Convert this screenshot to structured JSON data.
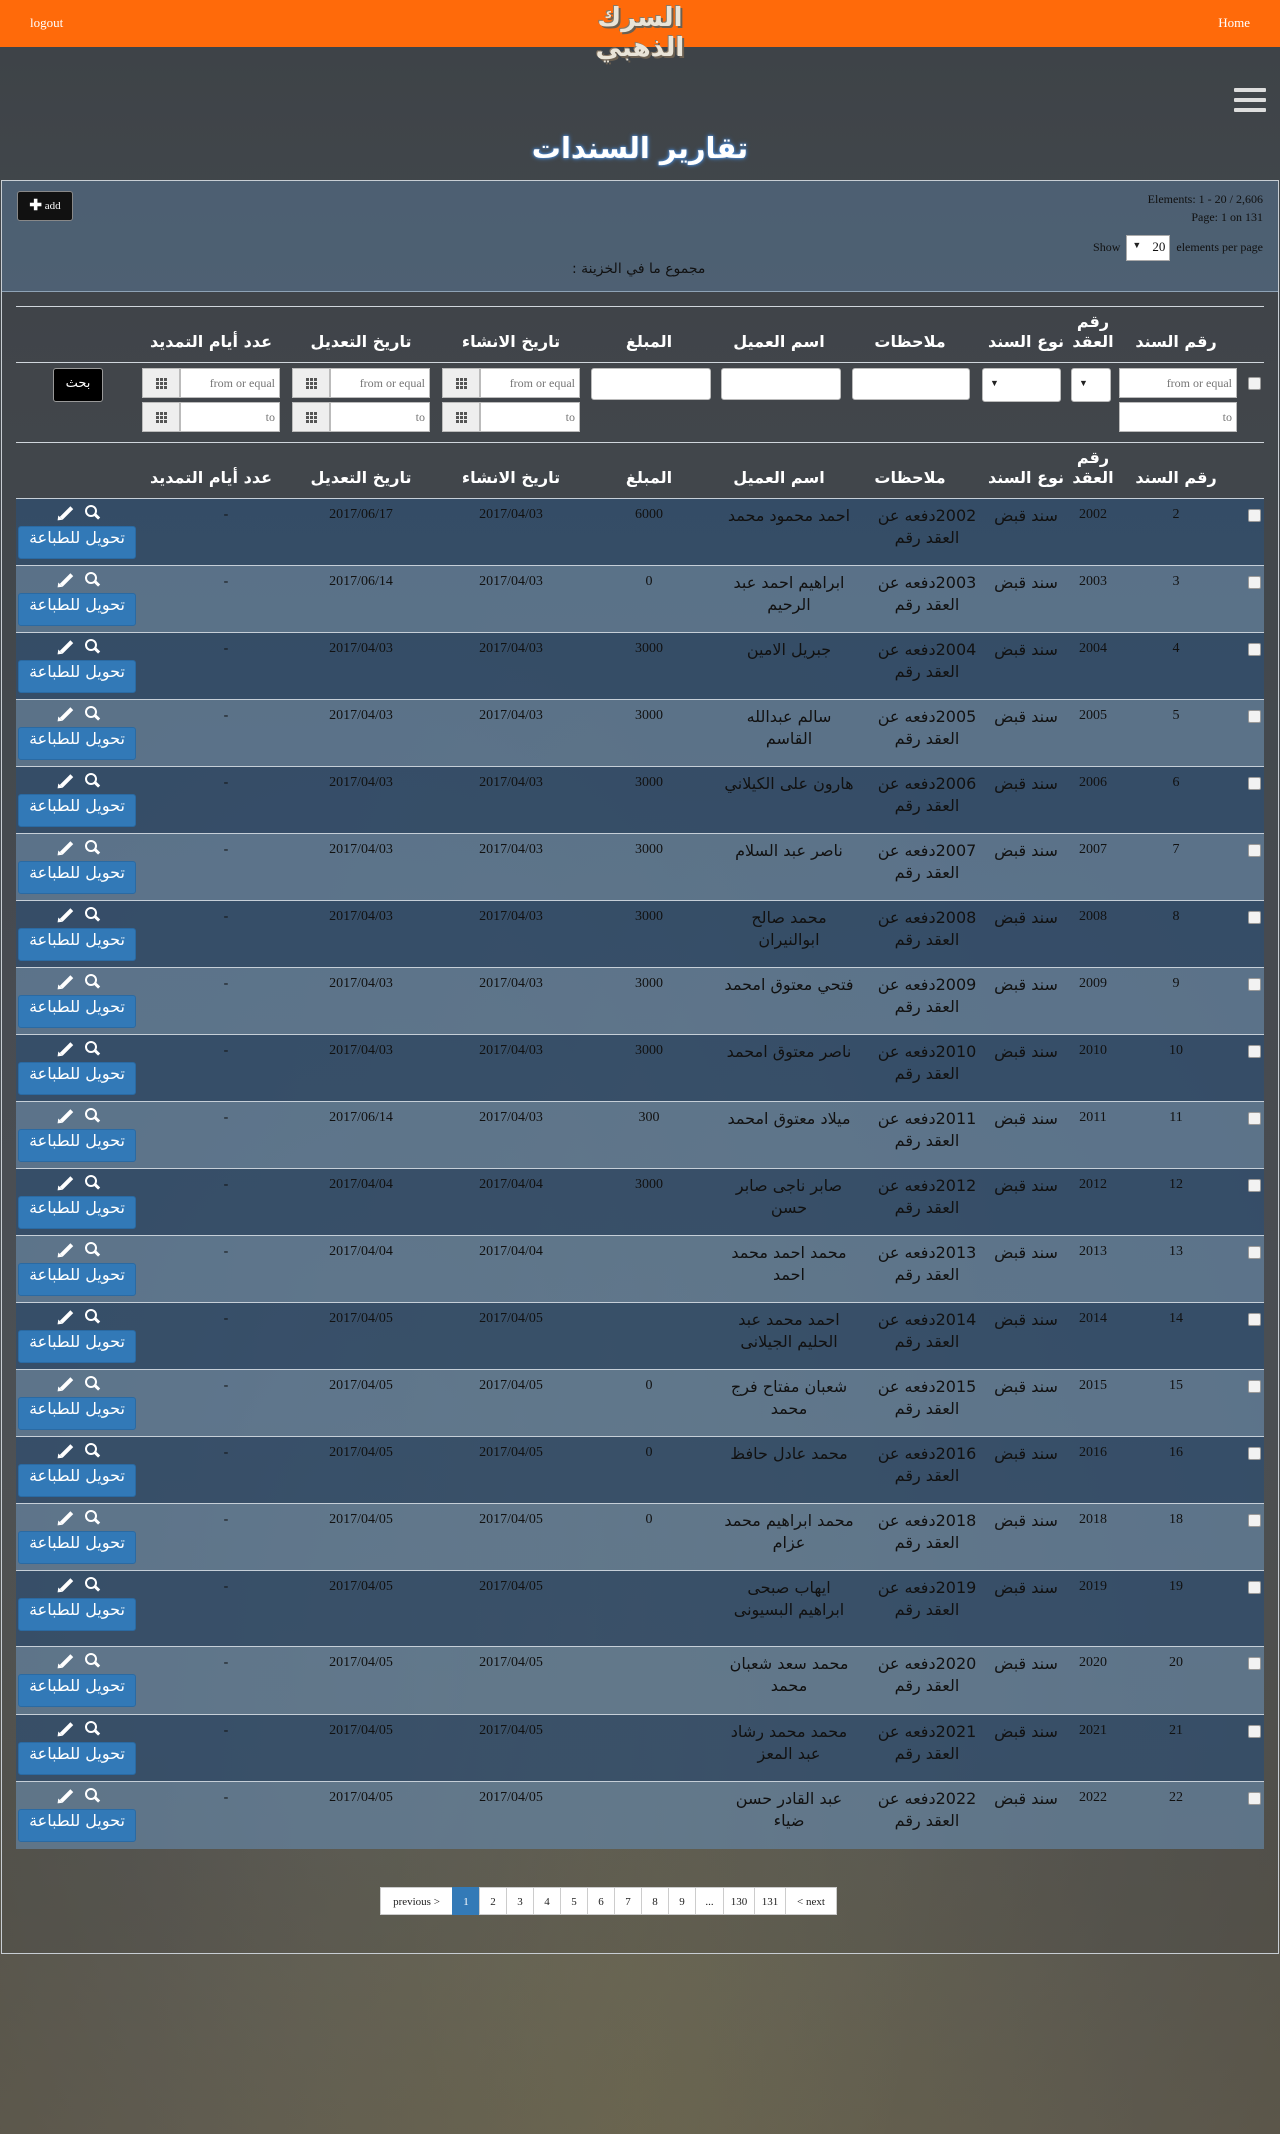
{
  "topbar": {
    "logout": "logout",
    "home": "Home",
    "logo": "السرك الذهبي"
  },
  "page_title": "تقارير السندات",
  "toolbar": {
    "add_label": "add",
    "elements_text": "Elements: 1 - 20 / 2,606",
    "page_text": "Page: 1 on 131",
    "show_label": "Show",
    "per_page_value": "20",
    "per_page_suffix": "elements per page",
    "treasury_text": "مجموع ما في الخزينة :"
  },
  "columns": {
    "bond_no": "رقم السند",
    "contract_no": "رقم العقد",
    "bond_type": "نوع السند",
    "notes": "ملاحظات",
    "client": "اسم العميل",
    "amount": "المبلغ",
    "created": "تاريخ الانشاء",
    "modified": "تاريخ التعديل",
    "ext_days": "عدد أيام التمديد"
  },
  "filters": {
    "from_placeholder": "from or equal",
    "to_placeholder": "to",
    "search_label": "بحث"
  },
  "row_actions": {
    "print_label": "تحويل للطباعة"
  },
  "rows": [
    {
      "id": "2",
      "contract": "2002",
      "type": "سند قبض",
      "notes": "2002دفعه عن العقد رقم",
      "client": "احمد محمود محمد",
      "amount": "6000",
      "created": "2017/04/03",
      "modified": "2017/06/17",
      "ext": "-"
    },
    {
      "id": "3",
      "contract": "2003",
      "type": "سند قبض",
      "notes": "2003دفعه عن العقد رقم",
      "client": "ابراهيم احمد عبد الرحيم",
      "amount": "0",
      "created": "2017/04/03",
      "modified": "2017/06/14",
      "ext": "-"
    },
    {
      "id": "4",
      "contract": "2004",
      "type": "سند قبض",
      "notes": "2004دفعه عن العقد رقم",
      "client": "جبريل الامين",
      "amount": "3000",
      "created": "2017/04/03",
      "modified": "2017/04/03",
      "ext": "-"
    },
    {
      "id": "5",
      "contract": "2005",
      "type": "سند قبض",
      "notes": "2005دفعه عن العقد رقم",
      "client": "سالم عبدالله القاسم",
      "amount": "3000",
      "created": "2017/04/03",
      "modified": "2017/04/03",
      "ext": "-"
    },
    {
      "id": "6",
      "contract": "2006",
      "type": "سند قبض",
      "notes": "2006دفعه عن العقد رقم",
      "client": "هارون على الكيلاني",
      "amount": "3000",
      "created": "2017/04/03",
      "modified": "2017/04/03",
      "ext": "-"
    },
    {
      "id": "7",
      "contract": "2007",
      "type": "سند قبض",
      "notes": "2007دفعه عن العقد رقم",
      "client": "ناصر عبد السلام",
      "amount": "3000",
      "created": "2017/04/03",
      "modified": "2017/04/03",
      "ext": "-"
    },
    {
      "id": "8",
      "contract": "2008",
      "type": "سند قبض",
      "notes": "2008دفعه عن العقد رقم",
      "client": "محمد صالح ابوالنيران",
      "amount": "3000",
      "created": "2017/04/03",
      "modified": "2017/04/03",
      "ext": "-"
    },
    {
      "id": "9",
      "contract": "2009",
      "type": "سند قبض",
      "notes": "2009دفعه عن العقد رقم",
      "client": "فتحي معتوق امحمد",
      "amount": "3000",
      "created": "2017/04/03",
      "modified": "2017/04/03",
      "ext": "-"
    },
    {
      "id": "10",
      "contract": "2010",
      "type": "سند قبض",
      "notes": "2010دفعه عن العقد رقم",
      "client": "ناصر معتوق امحمد",
      "amount": "3000",
      "created": "2017/04/03",
      "modified": "2017/04/03",
      "ext": "-"
    },
    {
      "id": "11",
      "contract": "2011",
      "type": "سند قبض",
      "notes": "2011دفعه عن العقد رقم",
      "client": "ميلاد معتوق امحمد",
      "amount": "300",
      "created": "2017/04/03",
      "modified": "2017/06/14",
      "ext": "-"
    },
    {
      "id": "12",
      "contract": "2012",
      "type": "سند قبض",
      "notes": "2012دفعه عن العقد رقم",
      "client": "صابر ناجى صابر حسن",
      "amount": "3000",
      "created": "2017/04/04",
      "modified": "2017/04/04",
      "ext": "-"
    },
    {
      "id": "13",
      "contract": "2013",
      "type": "سند قبض",
      "notes": "2013دفعه عن العقد رقم",
      "client": "محمد احمد محمد احمد",
      "amount": "",
      "created": "2017/04/04",
      "modified": "2017/04/04",
      "ext": "-"
    },
    {
      "id": "14",
      "contract": "2014",
      "type": "سند قبض",
      "notes": "2014دفعه عن العقد رقم",
      "client": "احمد محمد عبد الحليم الجيلانى",
      "amount": "",
      "created": "2017/04/05",
      "modified": "2017/04/05",
      "ext": "-"
    },
    {
      "id": "15",
      "contract": "2015",
      "type": "سند قبض",
      "notes": "2015دفعه عن العقد رقم",
      "client": "شعبان مفتاح فرج محمد",
      "amount": "0",
      "created": "2017/04/05",
      "modified": "2017/04/05",
      "ext": "-"
    },
    {
      "id": "16",
      "contract": "2016",
      "type": "سند قبض",
      "notes": "2016دفعه عن العقد رقم",
      "client": "محمد عادل حافظ",
      "amount": "0",
      "created": "2017/04/05",
      "modified": "2017/04/05",
      "ext": "-"
    },
    {
      "id": "18",
      "contract": "2018",
      "type": "سند قبض",
      "notes": "2018دفعه عن العقد رقم",
      "client": "محمد ابراهيم محمد عزام",
      "amount": "0",
      "created": "2017/04/05",
      "modified": "2017/04/05",
      "ext": "-"
    },
    {
      "id": "19",
      "contract": "2019",
      "type": "سند قبض",
      "notes": "2019دفعه عن العقد رقم",
      "client": "ايهاب صبحى ابراهيم البسيونى",
      "amount": "",
      "created": "2017/04/05",
      "modified": "2017/04/05",
      "ext": "-"
    },
    {
      "id": "20",
      "contract": "2020",
      "type": "سند قبض",
      "notes": "2020دفعه عن العقد رقم",
      "client": "محمد سعد شعبان محمد",
      "amount": "",
      "created": "2017/04/05",
      "modified": "2017/04/05",
      "ext": "-"
    },
    {
      "id": "21",
      "contract": "2021",
      "type": "سند قبض",
      "notes": "2021دفعه عن العقد رقم",
      "client": "محمد محمد رشاد عبد المعز",
      "amount": "",
      "created": "2017/04/05",
      "modified": "2017/04/05",
      "ext": "-"
    },
    {
      "id": "22",
      "contract": "2022",
      "type": "سند قبض",
      "notes": "2022دفعه عن العقد رقم",
      "client": "عبد القادر حسن ضياء",
      "amount": "",
      "created": "2017/04/05",
      "modified": "2017/04/05",
      "ext": "-"
    }
  ],
  "pagination": [
    "previous >",
    "1",
    "2",
    "3",
    "4",
    "5",
    "6",
    "7",
    "8",
    "9",
    "...",
    "130",
    "131",
    "< next"
  ],
  "pagination_active": "1",
  "colors": {
    "topbar": "#ff6a0a",
    "print_button": "#3279b7",
    "row_band": "#5a7898"
  }
}
